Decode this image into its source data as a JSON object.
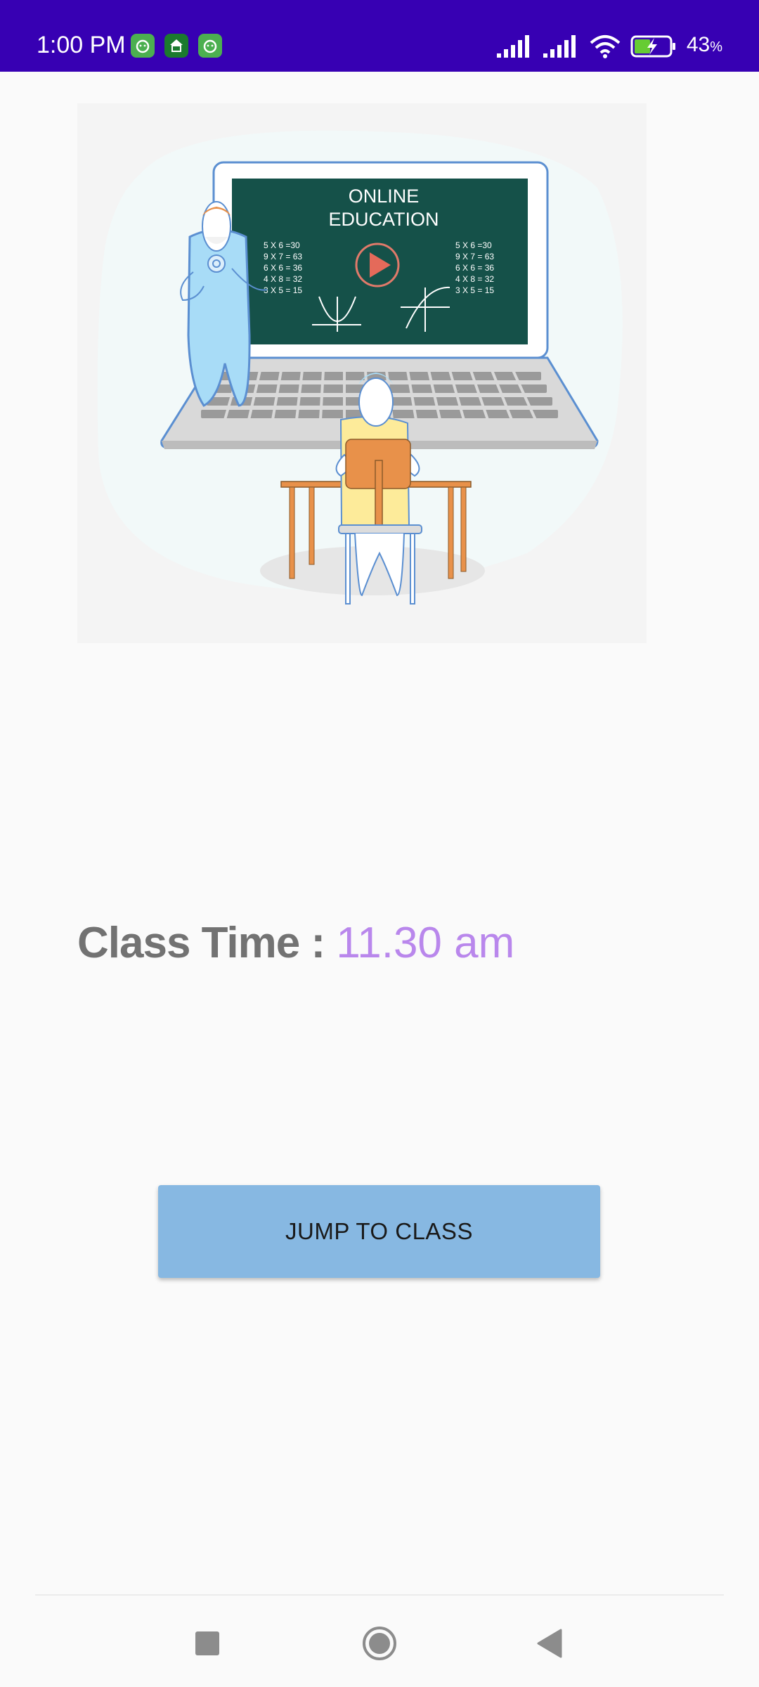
{
  "status_bar": {
    "time": "1:00 PM",
    "battery_percent": "43",
    "battery_unit": "%",
    "notification_icons": [
      "android-app-icon",
      "shelter-app-icon",
      "android-app-icon"
    ],
    "background_color": "#3700b3"
  },
  "illustration": {
    "board_title_line1": "ONLINE",
    "board_title_line2": "EDUCATION",
    "board_left_equations": [
      "5  X 6 =30",
      "9 X 7 = 63",
      "6 X 6 = 36",
      "4 X 8 = 32",
      "3 X 5 = 15"
    ],
    "board_right_equations": [
      "5  X 6 =30",
      "9 X 7 = 63",
      "6 X 6 = 36",
      "4 X 8 = 32",
      "3 X 5 = 15"
    ]
  },
  "class_time": {
    "label": "Class Time : ",
    "value": "11.30 am",
    "label_color": "#727272",
    "value_color": "#b987ec"
  },
  "jump_button": {
    "label": "JUMP TO CLASS",
    "color": "#87b8e2"
  },
  "nav_bar": {
    "buttons": [
      "recent-apps-icon",
      "home-icon",
      "back-icon"
    ]
  }
}
